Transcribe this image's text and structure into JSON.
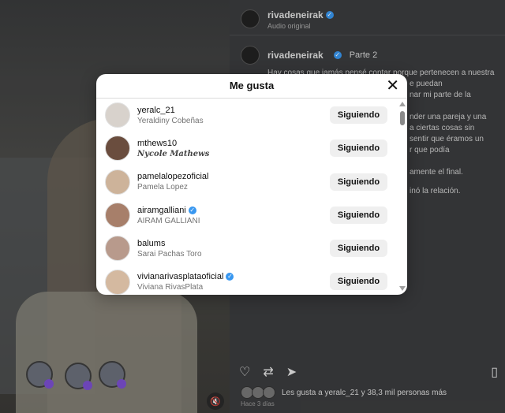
{
  "post": {
    "author": "rivadeneirak",
    "audio": "Audio original",
    "caption_title": "Parte 2",
    "caption_lines": [
      "Hay cosas que jamás pensé contar porque pertenecen a nuestra",
      "e puedan",
      "nar mi parte de la",
      "nder una pareja y una",
      "a ciertas cosas sin",
      "sentir que éramos un",
      "r que podía",
      "amente el final.",
      "inó la relación."
    ],
    "likes_text": "Les gusta a yeralc_21 y 38,3 mil personas más",
    "date": "Hace 3 días"
  },
  "modal": {
    "title": "Me gusta",
    "close_symbol": "✕",
    "users": [
      {
        "username": "yeralc_21",
        "fullname": "Yeraldiny Cobeñas",
        "verified": false,
        "button": "Siguiendo"
      },
      {
        "username": "mthews10",
        "fullname": "Nycole Mathews",
        "verified": false,
        "button": "Siguiendo"
      },
      {
        "username": "pamelalopezoficial",
        "fullname": "Pamela Lopez",
        "verified": false,
        "button": "Siguiendo"
      },
      {
        "username": "airamgalliani",
        "fullname": "AIRAM GALLIANI",
        "verified": true,
        "button": "Siguiendo"
      },
      {
        "username": "balums",
        "fullname": "Sarai Pachas Toro",
        "verified": false,
        "button": "Siguiendo"
      },
      {
        "username": "vivianarivasplataoficial",
        "fullname": "Viviana RivasPlata",
        "verified": true,
        "button": "Siguiendo"
      }
    ]
  },
  "colors": {
    "verified": "#3897f0",
    "button_bg": "#efefef",
    "panel_bg": "#3b3c3e"
  }
}
